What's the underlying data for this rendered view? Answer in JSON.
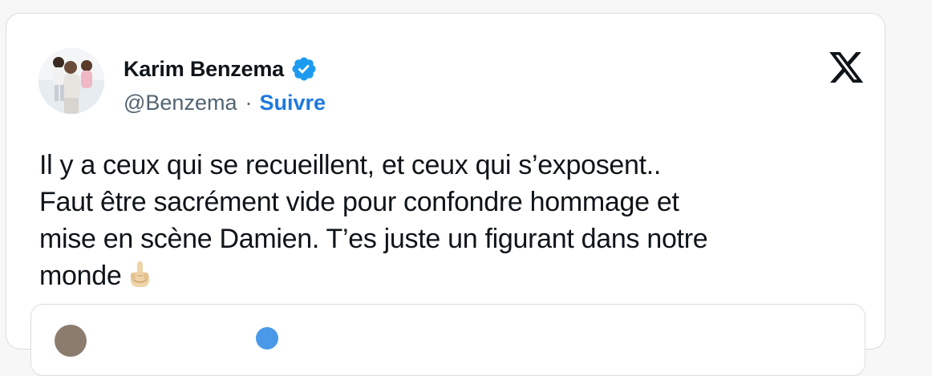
{
  "tweet": {
    "author_name": "Karim Benzema",
    "handle": "@Benzema",
    "separator": "·",
    "follow_label": "Suivre",
    "text_lines": [
      "Il y a ceux qui se recueillent, et ceux qui s’exposent..",
      "Faut être sacrément vide pour confondre hommage et",
      "mise en scène Damien. T’es juste un figurant dans notre",
      "monde"
    ],
    "emoji": "middle-finger-emoji",
    "verified_icon": "verified-badge-icon",
    "platform_logo": "x-logo-icon"
  },
  "colors": {
    "text": "#0f1419",
    "secondary": "#536471",
    "link": "#1d7adf",
    "verified": "#1d9bf0",
    "border": "#d9dde1"
  }
}
